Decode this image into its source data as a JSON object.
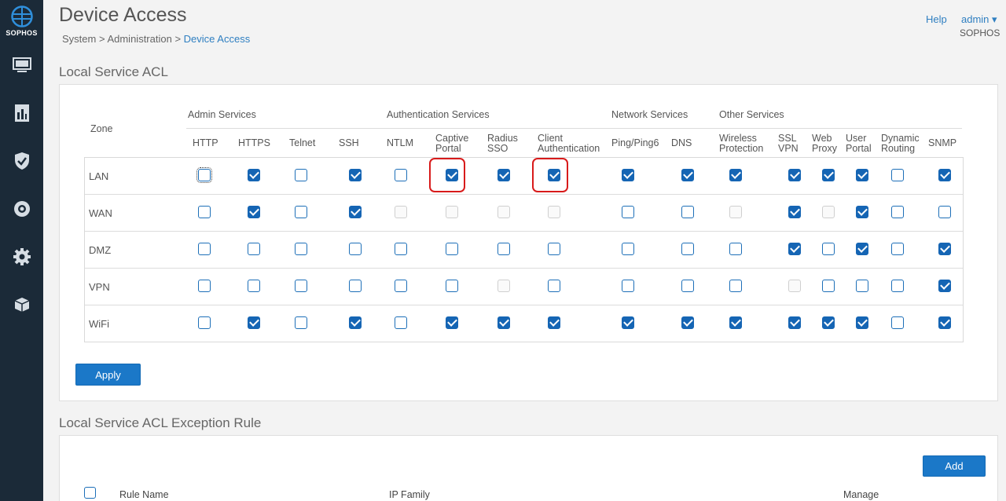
{
  "brand": {
    "logo_text": "SOPHOS"
  },
  "sidebar": {
    "items": [
      {
        "name": "monitor-icon"
      },
      {
        "name": "reports-icon"
      },
      {
        "name": "protect-icon"
      },
      {
        "name": "configure-icon"
      },
      {
        "name": "system-icon"
      },
      {
        "name": "packages-icon"
      }
    ]
  },
  "header": {
    "title": "Device Access",
    "breadcrumb": {
      "system": "System",
      "sep1": " > ",
      "admin": "Administration",
      "sep2": " > ",
      "current": "Device Access"
    },
    "help": "Help",
    "user": "admin ▾",
    "org": "SOPHOS"
  },
  "acl": {
    "section_title": "Local Service ACL",
    "zone_header": "Zone",
    "groups": [
      "Admin Services",
      "Authentication Services",
      "Network Services",
      "Other Services"
    ],
    "columns": [
      [
        "HTTP"
      ],
      [
        "HTTPS"
      ],
      [
        "Telnet"
      ],
      [
        "SSH"
      ],
      [
        "NTLM"
      ],
      [
        "Captive",
        "Portal"
      ],
      [
        "Radius",
        "SSO"
      ],
      [
        "Client",
        "Authentication"
      ],
      [
        "Ping/Ping6"
      ],
      [
        "DNS"
      ],
      [
        "Wireless",
        "Protection"
      ],
      [
        "SSL",
        "VPN"
      ],
      [
        "Web",
        "Proxy"
      ],
      [
        "User",
        "Portal"
      ],
      [
        "Dynamic",
        "Routing"
      ],
      [
        "SNMP"
      ]
    ],
    "rows": [
      {
        "zone": "LAN",
        "states": [
          "f",
          "c",
          "u",
          "c",
          "u",
          "c",
          "c",
          "c",
          "c",
          "c",
          "c",
          "c",
          "c",
          "c",
          "u",
          "c"
        ]
      },
      {
        "zone": "WAN",
        "states": [
          "u",
          "c",
          "u",
          "c",
          "d",
          "d",
          "d",
          "d",
          "u",
          "u",
          "d",
          "c",
          "d",
          "c",
          "u",
          "u"
        ]
      },
      {
        "zone": "DMZ",
        "states": [
          "u",
          "u",
          "u",
          "u",
          "u",
          "u",
          "u",
          "u",
          "u",
          "u",
          "u",
          "c",
          "u",
          "c",
          "u",
          "c"
        ]
      },
      {
        "zone": "VPN",
        "states": [
          "u",
          "u",
          "u",
          "u",
          "u",
          "u",
          "d",
          "u",
          "u",
          "u",
          "u",
          "d",
          "u",
          "u",
          "u",
          "c"
        ]
      },
      {
        "zone": "WiFi",
        "states": [
          "u",
          "c",
          "u",
          "c",
          "u",
          "c",
          "c",
          "c",
          "c",
          "c",
          "c",
          "c",
          "c",
          "c",
          "u",
          "c"
        ]
      }
    ],
    "apply_label": "Apply"
  },
  "exception": {
    "section_title": "Local Service ACL Exception Rule",
    "add_label": "Add",
    "columns": {
      "rule_name": "Rule Name",
      "ip_family": "IP Family",
      "manage": "Manage"
    }
  },
  "colors": {
    "accent": "#1b78c8",
    "sidebar": "#1b2a38",
    "highlight": "#d81b1b"
  }
}
